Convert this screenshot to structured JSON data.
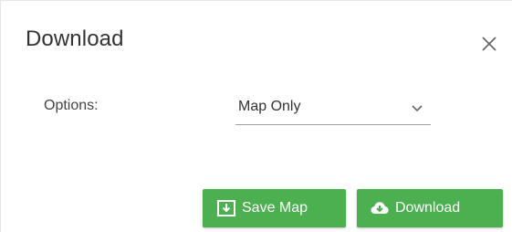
{
  "dialog": {
    "title": "Download",
    "close_icon": "close-icon"
  },
  "form": {
    "options_label": "Options:",
    "options_select": {
      "selected": "Map Only",
      "icon": "chevron-down-icon"
    }
  },
  "actions": {
    "save_map": {
      "label": "Save Map",
      "icon": "save-download-icon"
    },
    "download": {
      "label": "Download",
      "icon": "cloud-download-icon"
    }
  },
  "colors": {
    "button_bg": "#4caf50",
    "title_text": "#333333",
    "underline": "#9e9e9e"
  }
}
